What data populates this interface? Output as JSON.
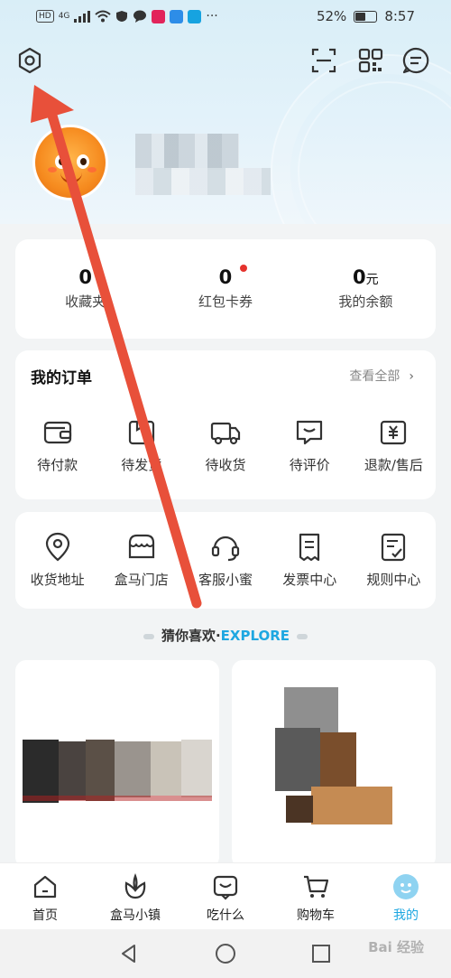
{
  "status_bar": {
    "network_badge": "HD",
    "signal_label": "4G",
    "more": "···",
    "battery": "52%",
    "battery_level": 0.52,
    "time": "8:57"
  },
  "header": {
    "settings_icon": "hexagon-settings-icon",
    "scan_icon": "scan-icon",
    "qr_icon": "qr-code-icon",
    "message_icon": "message-icon"
  },
  "stats": [
    {
      "value": "0",
      "unit": "",
      "label": "收藏夹",
      "dot": false
    },
    {
      "value": "0",
      "unit": "",
      "label": "红包卡券",
      "dot": true
    },
    {
      "value": "0",
      "unit": "元",
      "label": "我的余额",
      "dot": false
    }
  ],
  "orders": {
    "title": "我的订单",
    "more": "查看全部",
    "items": [
      {
        "label": "待付款",
        "icon": "wallet-icon"
      },
      {
        "label": "待发货",
        "icon": "box-icon"
      },
      {
        "label": "待收货",
        "icon": "truck-icon"
      },
      {
        "label": "待评价",
        "icon": "review-icon"
      },
      {
        "label": "退款/售后",
        "icon": "refund-icon"
      }
    ]
  },
  "services": [
    {
      "label": "收货地址",
      "icon": "location-icon"
    },
    {
      "label": "盒马门店",
      "icon": "store-icon"
    },
    {
      "label": "客服小蜜",
      "icon": "headset-icon"
    },
    {
      "label": "发票中心",
      "icon": "invoice-icon"
    },
    {
      "label": "规则中心",
      "icon": "rules-icon"
    }
  ],
  "explore": {
    "cn": "猜你喜欢",
    "sep": "·",
    "en": "EXPLORE"
  },
  "tabs": [
    {
      "label": "首页",
      "icon": "home-icon",
      "active": false
    },
    {
      "label": "盒马小镇",
      "icon": "flower-icon",
      "active": false
    },
    {
      "label": "吃什么",
      "icon": "smile-box-icon",
      "active": false
    },
    {
      "label": "购物车",
      "icon": "cart-icon",
      "active": false
    },
    {
      "label": "我的",
      "icon": "mascot-icon",
      "active": true
    }
  ],
  "watermark": "Bai 经验",
  "colors": {
    "accent": "#1ea7e1",
    "arrow": "#e8503a",
    "badge_dot": "#e5322d"
  }
}
